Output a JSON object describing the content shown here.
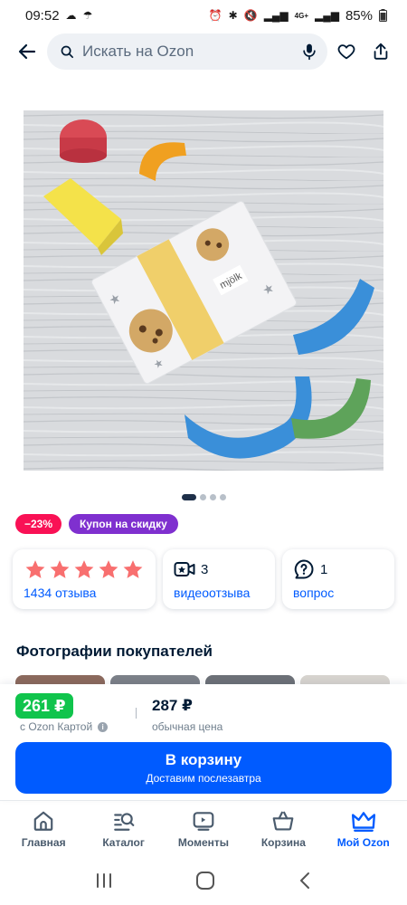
{
  "status_bar": {
    "time": "09:52",
    "network": "4G+",
    "battery": "85%"
  },
  "search": {
    "placeholder": "Искать на Ozon"
  },
  "product_image": {
    "brand_tag": "mjölk",
    "carousel_total": 4,
    "carousel_active": 0
  },
  "badges": {
    "discount": "−23%",
    "coupon": "Купон на скидку"
  },
  "cards": {
    "rating": {
      "stars": 5,
      "reviews_label": "1434 отзыва"
    },
    "video": {
      "count": "3",
      "label": "видеоотзыва"
    },
    "questions": {
      "count": "1",
      "label": "вопрос"
    }
  },
  "buyer_photos": {
    "title": "Фотографии покупателей"
  },
  "price": {
    "ozon_card_price": "261 ₽",
    "ozon_card_caption": "с Ozon Картой",
    "regular_price": "287 ₽",
    "regular_caption": "обычная цена"
  },
  "cart_button": {
    "label": "В корзину",
    "sublabel": "Доставим послезавтра"
  },
  "tab_bar": {
    "items": [
      {
        "label": "Главная",
        "icon": "home-icon"
      },
      {
        "label": "Каталог",
        "icon": "catalog-icon"
      },
      {
        "label": "Моменты",
        "icon": "moments-icon"
      },
      {
        "label": "Корзина",
        "icon": "cart-icon"
      },
      {
        "label": "Мой Ozon",
        "icon": "crown-icon"
      }
    ],
    "active_index": 4
  },
  "colors": {
    "accent": "#005bff",
    "ozon_card_green": "#10c44c",
    "discount_pink": "#f91155",
    "coupon_purple": "#7f30cf",
    "star": "#f86f6f"
  }
}
